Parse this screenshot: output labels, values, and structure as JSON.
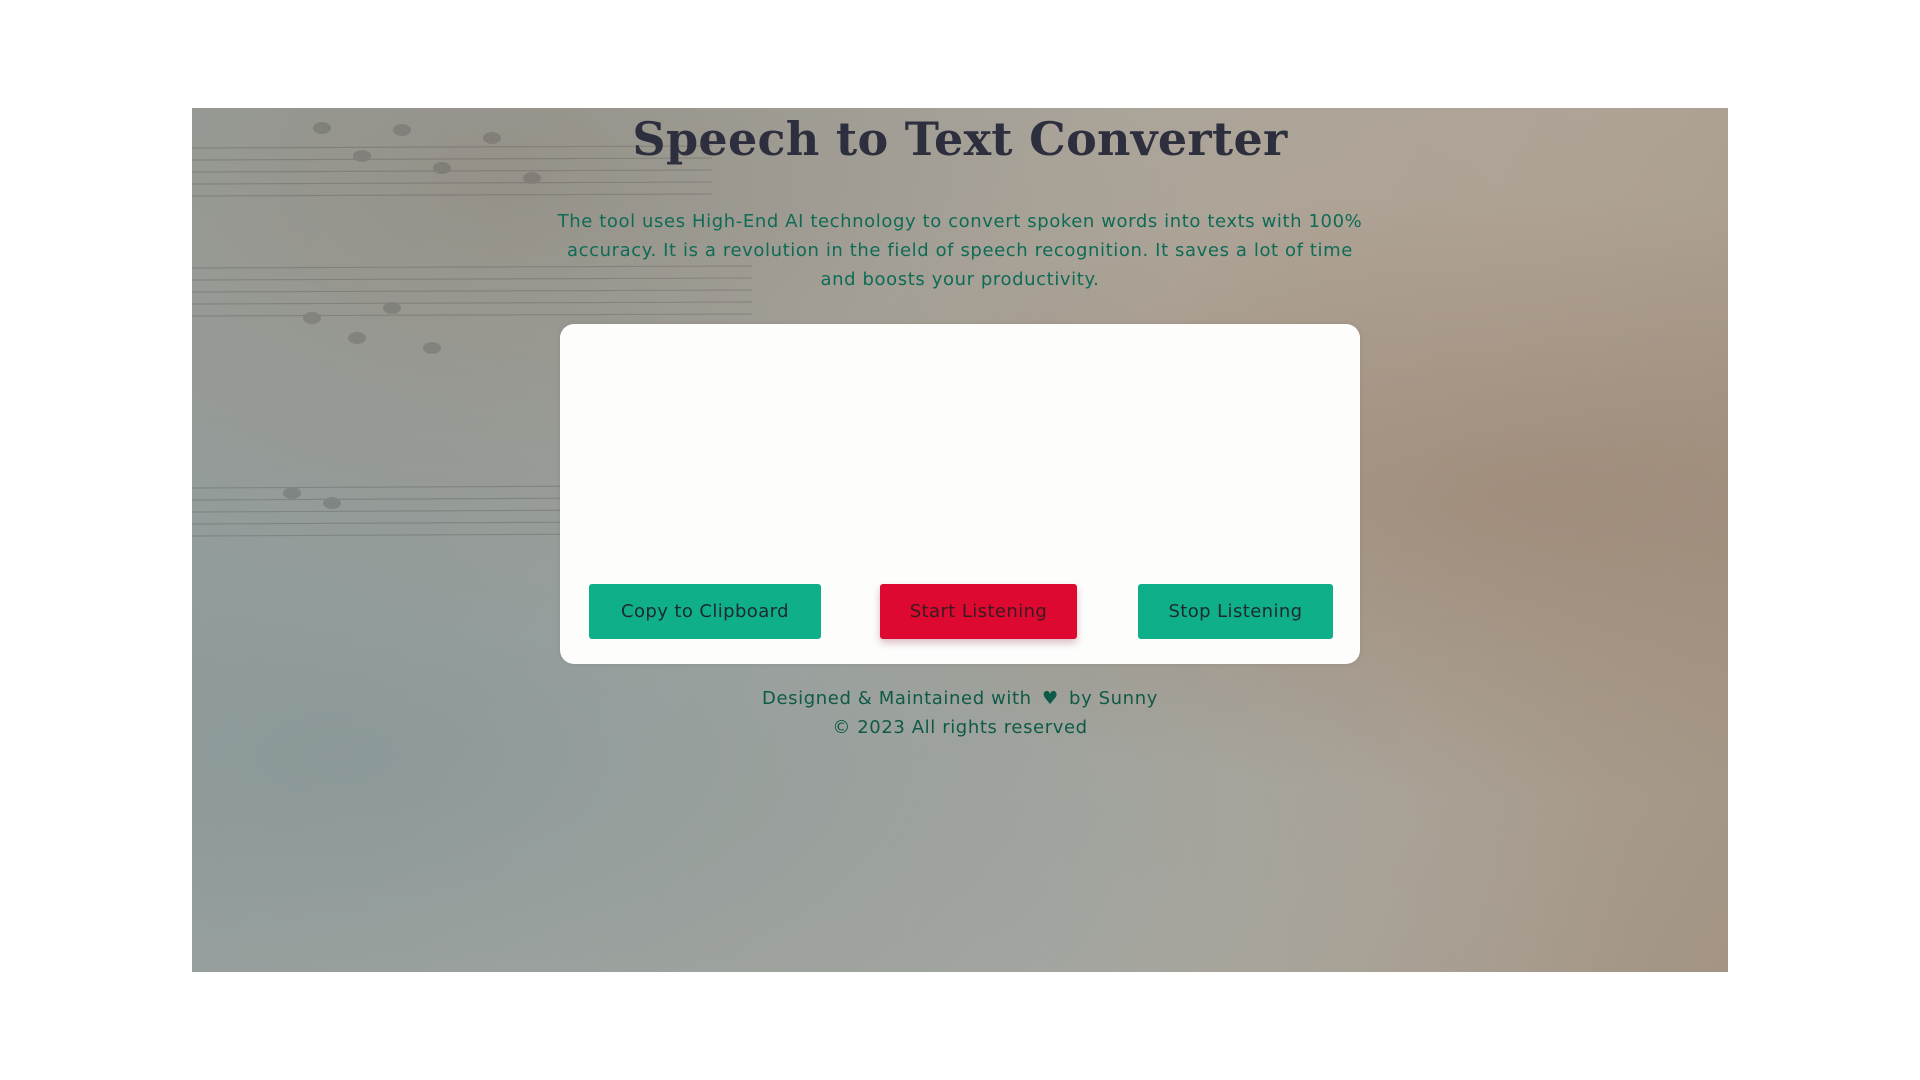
{
  "page": {
    "title": "Speech to Text Converter",
    "description": "The tool uses High-End AI technology to convert spoken words into texts with 100% accuracy. It is a revolution in the field of speech recognition. It saves a lot of time and boosts your productivity."
  },
  "transcript": {
    "value": "",
    "placeholder": ""
  },
  "buttons": {
    "copy_label": "Copy to Clipboard",
    "start_label": "Start Listening",
    "stop_label": "Stop Listening"
  },
  "footer": {
    "designed_prefix": "Designed & Maintained with",
    "heart_icon": "heart-icon",
    "designed_suffix": "by Sunny",
    "copyright": "© 2023 All rights reserved"
  },
  "colors": {
    "accent_green": "#0faf89",
    "accent_red": "#dd0930",
    "text_green": "#0e6b56",
    "title": "#2e2f3e"
  }
}
